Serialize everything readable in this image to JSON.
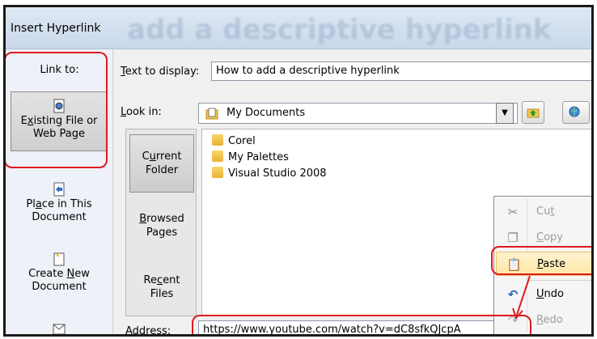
{
  "dialog": {
    "title": "Insert Hyperlink",
    "ghost_banner": "add a descriptive hyperlink"
  },
  "link_to": {
    "label": "Link to:",
    "items": [
      {
        "line1_pre": "E",
        "line1_acc": "x",
        "line1_post": "isting File or",
        "line2": "Web Page",
        "selected": true
      },
      {
        "line1_pre": "Pl",
        "line1_acc": "a",
        "line1_post": "ce in This",
        "line2": "Document",
        "selected": false
      },
      {
        "line1_pre": "Create ",
        "line1_acc": "N",
        "line1_post": "ew",
        "line2": "Document",
        "selected": false
      }
    ]
  },
  "text_to_display": {
    "label_acc": "T",
    "label_rest": "ext to display:",
    "value": "How to add a descriptive hyperlink"
  },
  "look_in": {
    "label_acc": "L",
    "label_rest": "ook in:",
    "value": "My Documents"
  },
  "nav": {
    "items": [
      {
        "line1_pre": "C",
        "line1_acc": "u",
        "line1_post": "rrent",
        "line2": "Folder",
        "selected": true
      },
      {
        "line1_pre": "",
        "line1_acc": "B",
        "line1_post": "rowsed",
        "line2": "Pages",
        "selected": false
      },
      {
        "line1_pre": "Re",
        "line1_acc": "c",
        "line1_post": "ent",
        "line2": "Files",
        "selected": false
      }
    ]
  },
  "files": [
    "Corel",
    "My Palettes",
    "Visual Studio 2008"
  ],
  "address": {
    "label": "Address:",
    "value": "https://www.youtube.com/watch?v=dC8sfkQJcpA"
  },
  "context_menu": {
    "items": [
      {
        "pre": "Cu",
        "acc": "t",
        "post": "",
        "icon": "scissors-icon",
        "glyph": "✂",
        "disabled": true
      },
      {
        "pre": "",
        "acc": "C",
        "post": "opy",
        "icon": "copy-icon",
        "glyph": "❐",
        "disabled": true
      },
      {
        "pre": "",
        "acc": "P",
        "post": "aste",
        "icon": "paste-icon",
        "glyph": "📋",
        "disabled": false
      },
      {
        "pre": "",
        "acc": "U",
        "post": "ndo",
        "icon": "undo-icon",
        "glyph": "↶",
        "disabled": false
      },
      {
        "pre": "",
        "acc": "R",
        "post": "edo",
        "icon": "redo-icon",
        "glyph": "↷",
        "disabled": true
      }
    ]
  },
  "colors": {
    "highlight_red": "#e0191e",
    "menu_hover": "#fde7a6"
  }
}
